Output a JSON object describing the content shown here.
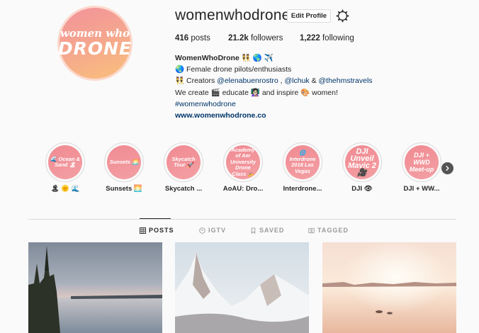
{
  "profile": {
    "username": "womenwhodrone",
    "edit_button": "Edit Profile",
    "avatar_text_top": "women who",
    "avatar_text_bottom": "DRONE",
    "stats": {
      "posts_count": "416",
      "posts_label": "posts",
      "followers_count": "21.2k",
      "followers_label": "followers",
      "following_count": "1,222",
      "following_label": "following"
    },
    "bio": {
      "name": "WomenWhoDrone 👯 🌎 ✈️",
      "line1": "🌏 Female drone pilots/enthusiasts",
      "line2_prefix": "👯 Creators ",
      "creator1": "@elenabuenrostro",
      "sep1": " , ",
      "creator2": "@lchuk",
      "sep2": " & ",
      "creator3": "@thehmstravels",
      "line3": "We create 🎬 educate 👩🏻‍🏫 and inspire 🎨 women!",
      "hashtag": "#womenwhodrone",
      "url": "www.womenwhodrone.co"
    }
  },
  "highlights": [
    {
      "circle_text": "🌊 Ocean & Sand 🏝",
      "label": "🏝 🌞 🌊"
    },
    {
      "circle_text": "Sunsets 🌅",
      "label": "Sunsets 🌅"
    },
    {
      "circle_text": "Skycatch Tour 🚀",
      "label": "Skycatch ..."
    },
    {
      "circle_text": "Academy of Aer University Drone Class 🚁",
      "label": "AoAU: Dro..."
    },
    {
      "circle_text": "🌐 Interdrone 2018 Las Vegas",
      "label": "Interdrone..."
    },
    {
      "circle_text": "DJI Unveil Mavic 2 🎥",
      "label": "DJI 👁"
    },
    {
      "circle_text": "DJI + WWD Meet-up",
      "label": "DJI + WW..."
    }
  ],
  "tabs": [
    {
      "label": "POSTS",
      "icon": "grid-icon",
      "active": true
    },
    {
      "label": "IGTV",
      "icon": "igtv-icon",
      "active": false
    },
    {
      "label": "SAVED",
      "icon": "bookmark-icon",
      "active": false
    },
    {
      "label": "TAGGED",
      "icon": "tag-icon",
      "active": false
    }
  ],
  "colors": {
    "highlight_pink": "#f08a92",
    "avatar_gradient_start": "#f2929a",
    "avatar_gradient_end": "#f9c07a",
    "link_blue": "#003569"
  }
}
